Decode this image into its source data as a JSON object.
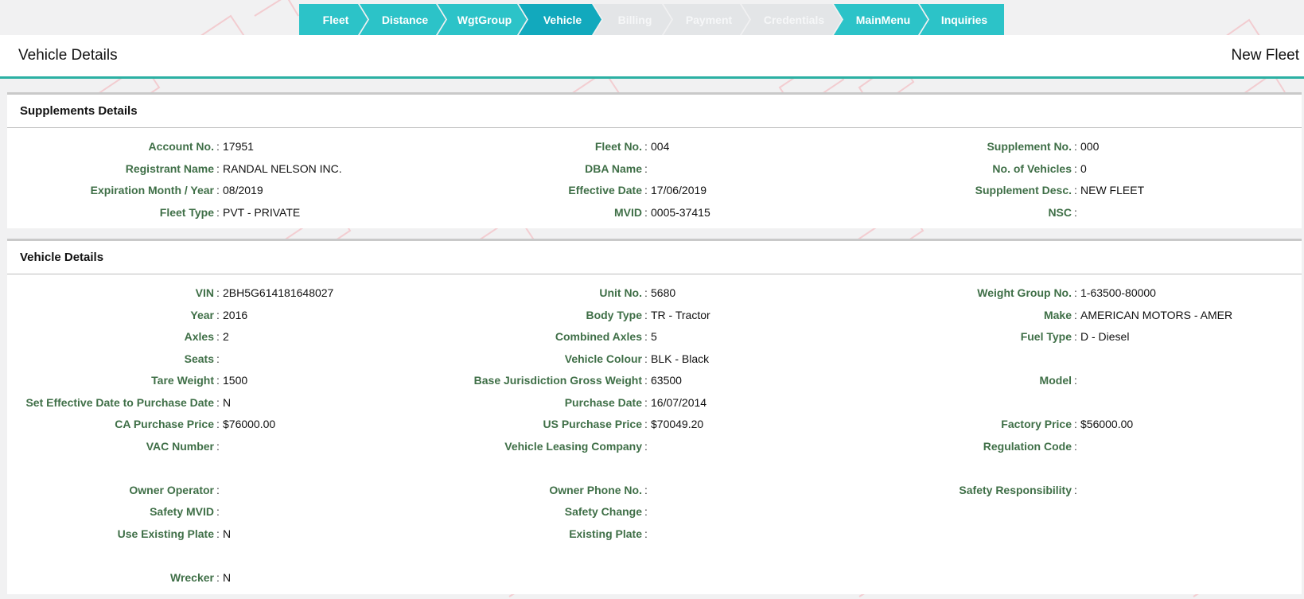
{
  "wizard": {
    "steps": [
      {
        "label": "Fleet",
        "state": "done"
      },
      {
        "label": "Distance",
        "state": "done"
      },
      {
        "label": "WgtGroup",
        "state": "done"
      },
      {
        "label": "Vehicle",
        "state": "active"
      },
      {
        "label": "Billing",
        "state": "disabled"
      },
      {
        "label": "Payment",
        "state": "disabled"
      },
      {
        "label": "Credentials",
        "state": "disabled"
      },
      {
        "label": "MainMenu",
        "state": "done"
      },
      {
        "label": "Inquiries",
        "state": "done"
      }
    ]
  },
  "header": {
    "title": "Vehicle Details",
    "right_title": "New Fleet"
  },
  "supplements": {
    "title": "Supplements Details",
    "rows": [
      [
        {
          "label": "Account No.",
          "value": "17951"
        },
        {
          "label": "Fleet No.",
          "value": "004"
        },
        {
          "label": "Supplement No.",
          "value": "000"
        }
      ],
      [
        {
          "label": "Registrant Name",
          "value": "RANDAL NELSON INC."
        },
        {
          "label": "DBA Name",
          "value": ""
        },
        {
          "label": "No. of Vehicles",
          "value": "0"
        }
      ],
      [
        {
          "label": "Expiration Month / Year",
          "value": "08/2019"
        },
        {
          "label": "Effective Date",
          "value": "17/06/2019"
        },
        {
          "label": "Supplement Desc.",
          "value": "NEW FLEET"
        }
      ],
      [
        {
          "label": "Fleet Type",
          "value": "PVT - PRIVATE"
        },
        {
          "label": "MVID",
          "value": "0005-37415"
        },
        {
          "label": "NSC",
          "value": ""
        }
      ]
    ]
  },
  "vehicle": {
    "title": "Vehicle Details",
    "rows": [
      [
        {
          "label": "VIN",
          "value": "2BH5G614181648027"
        },
        {
          "label": "Unit No.",
          "value": "5680"
        },
        {
          "label": "Weight Group No.",
          "value": "1-63500-80000"
        }
      ],
      [
        {
          "label": "Year",
          "value": "2016"
        },
        {
          "label": "Body Type",
          "value": "TR - Tractor"
        },
        {
          "label": "Make",
          "value": "AMERICAN MOTORS - AMER"
        }
      ],
      [
        {
          "label": "Axles",
          "value": "2"
        },
        {
          "label": "Combined Axles",
          "value": "5"
        },
        {
          "label": "Fuel Type",
          "value": "D - Diesel"
        }
      ],
      [
        {
          "label": "Seats",
          "value": ""
        },
        {
          "label": "Vehicle Colour",
          "value": "BLK - Black"
        },
        null
      ],
      [
        {
          "label": "Tare Weight",
          "value": "1500"
        },
        {
          "label": "Base Jurisdiction Gross Weight",
          "value": "63500"
        },
        {
          "label": "Model",
          "value": ""
        }
      ],
      [
        {
          "label": "Set Effective Date to Purchase Date",
          "value": "N"
        },
        {
          "label": "Purchase Date",
          "value": "16/07/2014"
        },
        null
      ],
      [
        {
          "label": "CA Purchase Price",
          "value": "$76000.00"
        },
        {
          "label": "US Purchase Price",
          "value": "$70049.20"
        },
        {
          "label": "Factory Price",
          "value": "$56000.00"
        }
      ],
      [
        {
          "label": "VAC Number",
          "value": ""
        },
        {
          "label": "Vehicle Leasing Company",
          "value": ""
        },
        {
          "label": "Regulation Code",
          "value": ""
        }
      ],
      null,
      [
        {
          "label": "Owner Operator",
          "value": ""
        },
        {
          "label": "Owner Phone No.",
          "value": ""
        },
        {
          "label": "Safety Responsibility",
          "value": ""
        }
      ],
      [
        {
          "label": "Safety MVID",
          "value": ""
        },
        {
          "label": "Safety Change",
          "value": ""
        },
        null
      ],
      [
        {
          "label": "Use Existing Plate",
          "value": "N"
        },
        {
          "label": "Existing Plate",
          "value": ""
        },
        null
      ],
      null,
      [
        {
          "label": "Wrecker",
          "value": "N"
        },
        null,
        null
      ]
    ]
  },
  "colors": {
    "accent": "#2cc3c8",
    "active": "#12a9bd",
    "label": "#3f6f47",
    "underline": "#2bb0a3"
  }
}
